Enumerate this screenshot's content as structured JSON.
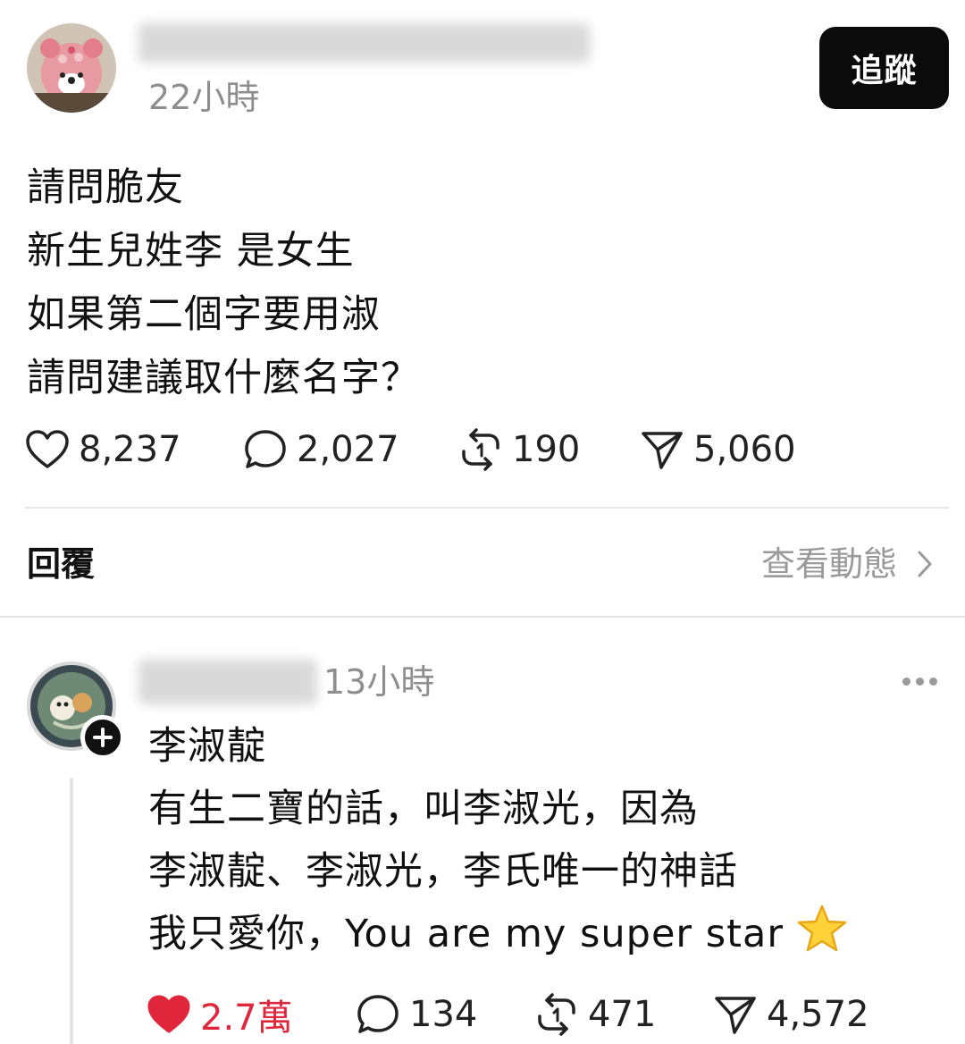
{
  "post": {
    "author_avatar_icon": "pink-bear-avatar",
    "time": "22小時",
    "follow_label": "追蹤",
    "lines": [
      "請問脆友",
      "新生兒姓李 是女生",
      "如果第二個字要用淑",
      "請問建議取什麼名字？"
    ],
    "stats": {
      "likes": "8,237",
      "comments": "2,027",
      "reposts": "190",
      "shares": "5,060"
    }
  },
  "bar": {
    "reply_label": "回覆",
    "activity_label": "查看動態"
  },
  "reply": {
    "author_avatar_icon": "manhole-cover-avatar",
    "time": "13小時",
    "lines": [
      "李淑靛",
      "有生二寶的話，叫李淑光，因為",
      "李淑靛、李淑光，李氏唯一的神話",
      "我只愛你，You are my super star"
    ],
    "stats": {
      "likes": "2.7萬",
      "comments": "134",
      "reposts": "471",
      "shares": "4,572"
    }
  },
  "colors": {
    "accent_like": "#e0263b",
    "muted": "#8e8e8e",
    "button_bg": "#0b0b0b"
  }
}
